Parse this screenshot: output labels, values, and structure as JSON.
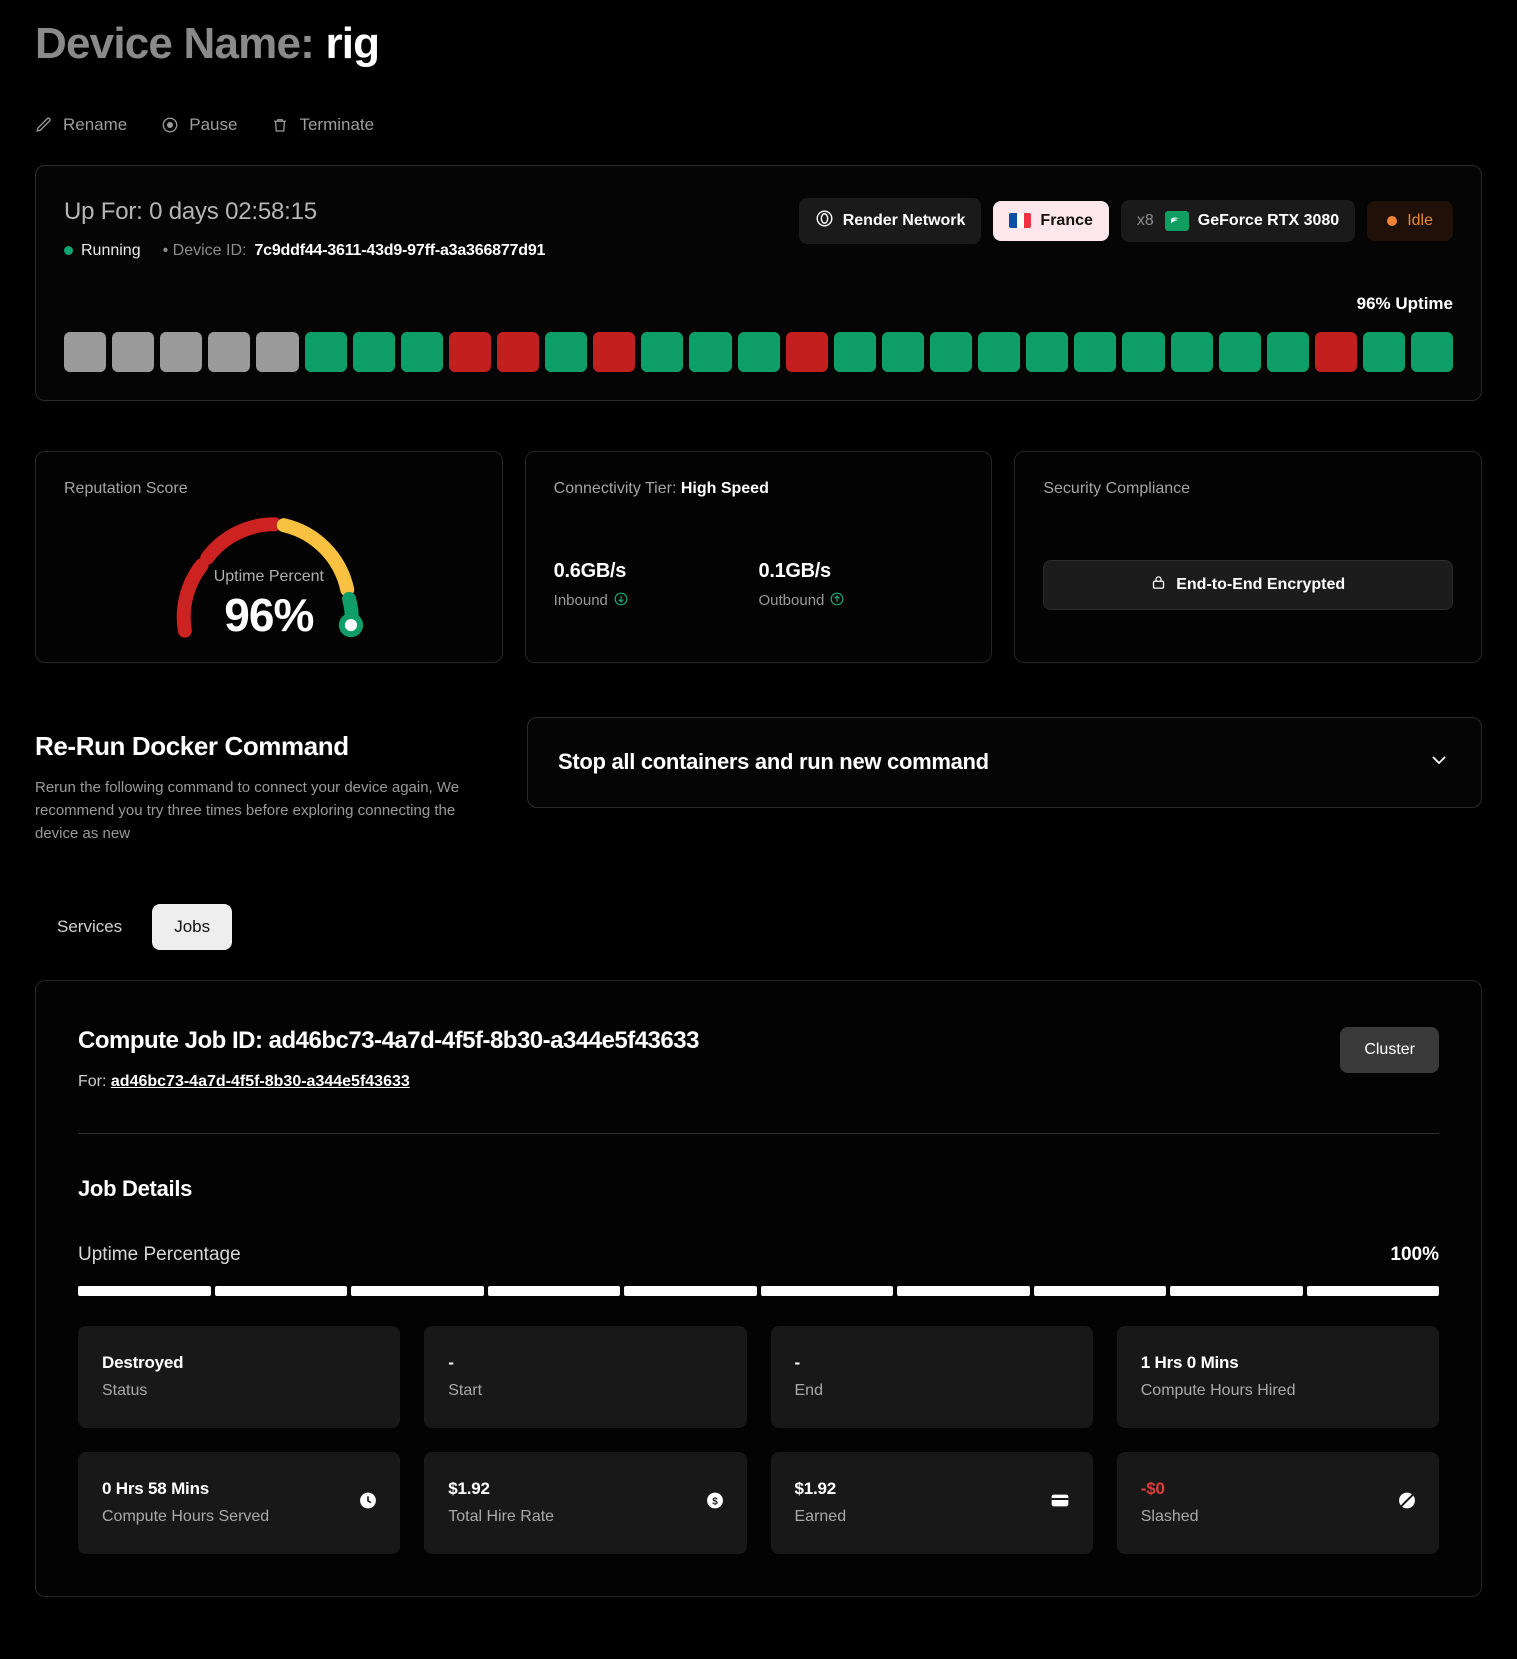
{
  "header": {
    "title_prefix": "Device Name:",
    "device_name": "rig",
    "actions": [
      {
        "label": "Rename",
        "icon": "pencil-icon"
      },
      {
        "label": "Pause",
        "icon": "pause-circle-icon"
      },
      {
        "label": "Terminate",
        "icon": "trash-icon"
      }
    ]
  },
  "status": {
    "up_for": "Up For: 0 days 02:58:15",
    "state": "Running",
    "device_id_label": "• Device ID:",
    "device_id": "7c9ddf44-3611-43d9-97ff-a3a366877d91",
    "badges": {
      "network": "Render Network",
      "country": "France",
      "gpu_count": "x8",
      "gpu_model": "GeForce RTX 3080",
      "activity": "Idle"
    },
    "uptime_label": "96% Uptime",
    "colors": {
      "green": "#0f9d68",
      "red": "#c31f1f",
      "gray": "#9a9a9a",
      "orange": "#ef8436"
    },
    "bars": [
      "gray",
      "gray",
      "gray",
      "gray",
      "gray",
      "green",
      "green",
      "green",
      "red",
      "red",
      "green",
      "red",
      "green",
      "green",
      "green",
      "red",
      "green",
      "green",
      "green",
      "green",
      "green",
      "green",
      "green",
      "green",
      "green",
      "green",
      "red",
      "green",
      "green"
    ]
  },
  "reputation": {
    "label": "Reputation Score",
    "caption": "Uptime Percent",
    "value": "96%",
    "percent": 96,
    "arc_colors": {
      "low": "#cc2222",
      "mid": "#f9c140",
      "high": "#0f9d68"
    }
  },
  "connectivity": {
    "label_prefix": "Connectivity Tier:",
    "tier": "High Speed",
    "inbound_value": "0.6GB/s",
    "inbound_label": "Inbound",
    "inbound_icon": "arrow-down-circle-icon",
    "outbound_value": "0.1GB/s",
    "outbound_label": "Outbound",
    "outbound_icon": "arrow-up-circle-icon"
  },
  "security": {
    "label": "Security Compliance",
    "button_label": "End-to-End Encrypted",
    "button_icon": "lock-icon"
  },
  "docker": {
    "heading": "Re-Run Docker Command",
    "description": "Rerun the following command to connect your device again, We recommend you try three times before exploring connecting the device as new",
    "accordion_title": "Stop all containers and run new command",
    "accordion_icon": "chevron-down-icon"
  },
  "tabs": [
    {
      "label": "Services",
      "active": false
    },
    {
      "label": "Jobs",
      "active": true
    }
  ],
  "job": {
    "title_prefix": "Compute Job ID:",
    "job_id": "ad46bc73-4a7d-4f5f-8b30-a344e5f43633",
    "for_label": "For:",
    "for_value": "ad46bc73-4a7d-4f5f-8b30-a344e5f43633",
    "cluster_button": "Cluster",
    "details_heading": "Job Details",
    "uptime_percentage_label": "Uptime Percentage",
    "uptime_percentage_value": "100%",
    "uptime_segments": 10,
    "metrics": [
      {
        "value": "Destroyed",
        "label": "Status",
        "icon": "",
        "negative": false
      },
      {
        "value": "-",
        "label": "Start",
        "icon": "",
        "negative": false
      },
      {
        "value": "-",
        "label": "End",
        "icon": "",
        "negative": false
      },
      {
        "value": "1 Hrs 0 Mins",
        "label": "Compute Hours Hired",
        "icon": "",
        "negative": false
      },
      {
        "value": "0 Hrs 58 Mins",
        "label": "Compute Hours Served",
        "icon": "clock-icon",
        "negative": false
      },
      {
        "value": "$1.92",
        "label": "Total Hire Rate",
        "icon": "dollar-circle-icon",
        "negative": false
      },
      {
        "value": "$1.92",
        "label": "Earned",
        "icon": "card-icon",
        "negative": false
      },
      {
        "value": "-$0",
        "label": "Slashed",
        "icon": "slash-icon",
        "negative": true
      }
    ]
  }
}
